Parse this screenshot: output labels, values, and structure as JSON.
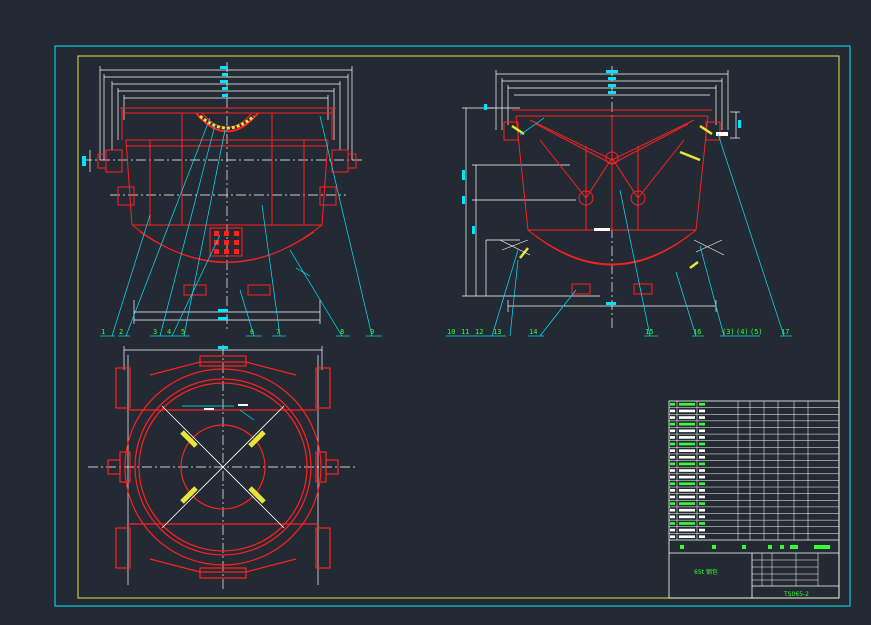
{
  "drawing": {
    "title_text": "65t 钢包",
    "drawing_number": "TS065-2",
    "colors": {
      "background": "#232a33",
      "outer_frame": "#00e5ff",
      "inner_frame": "#e6e63a",
      "part_outline": "#ff2020",
      "dimension": "#ffffff",
      "leader": "#00e5ff",
      "label_text": "#33ff33"
    }
  },
  "views": {
    "front": {
      "callouts": [
        "1",
        "2",
        "3",
        "4",
        "5",
        "6",
        "7",
        "8",
        "9"
      ]
    },
    "side": {
      "callouts": [
        "10",
        "11",
        "12",
        "13",
        "14",
        "15",
        "16",
        "(3)",
        "(4)",
        "(5)",
        "17"
      ]
    },
    "top": {
      "callouts": []
    }
  },
  "title_block": {
    "parts_rows": 21
  }
}
